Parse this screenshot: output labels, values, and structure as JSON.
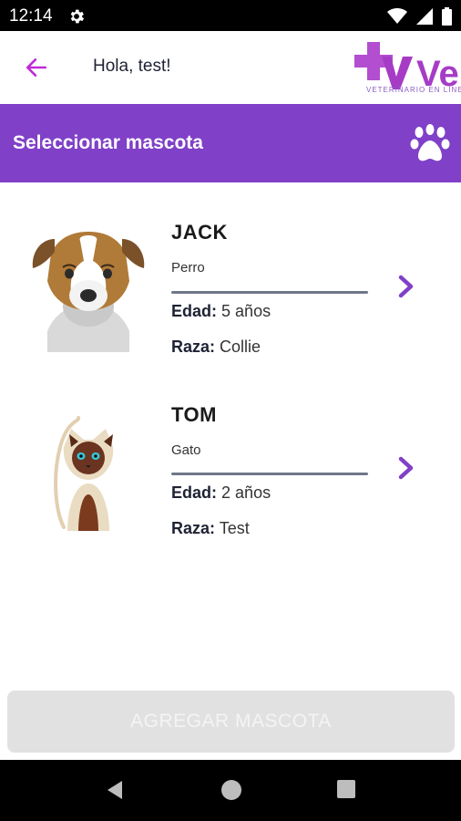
{
  "status_bar": {
    "time": "12:14",
    "icons": [
      "gear-icon",
      "wifi-icon",
      "signal-icon",
      "battery-icon"
    ]
  },
  "app_bar": {
    "greeting": "Hola, test!",
    "logo_text": "Vel",
    "logo_tagline": "VETERINARIO EN LÍNEA"
  },
  "header": {
    "title": "Seleccionar mascota",
    "icon": "paw-icon"
  },
  "labels": {
    "age": "Edad:",
    "breed": "Raza:"
  },
  "pets": [
    {
      "name": "JACK",
      "species": "Perro",
      "age": "5 años",
      "breed": "Collie"
    },
    {
      "name": "TOM",
      "species": "Gato",
      "age": "2 años",
      "breed": "Test"
    }
  ],
  "add_button": {
    "label": "AGREGAR MASCOTA",
    "enabled": false
  },
  "colors": {
    "primary": "#8040c8",
    "logo": "#a63cc6"
  }
}
